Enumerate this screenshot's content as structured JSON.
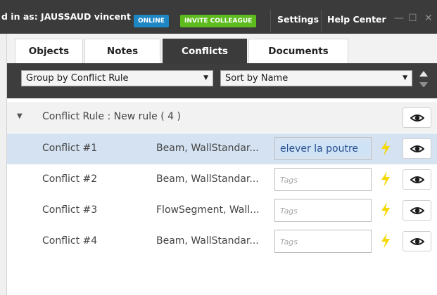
{
  "topbar": {
    "logged_in_text": "d in as: JAUSSAUD vincent",
    "online_badge": "ONLINE",
    "invite_button": "INVITE COLLEAGUE",
    "settings_label": "Settings",
    "help_label": "Help Center",
    "minimize_glyph": "—",
    "maximize_glyph": "☐",
    "close_glyph": "✕"
  },
  "tabs": [
    {
      "label": "Objects",
      "active": false
    },
    {
      "label": "Notes",
      "active": false
    },
    {
      "label": "Conflicts",
      "active": true
    },
    {
      "label": "Documents",
      "active": false
    }
  ],
  "toolbar": {
    "group_by_value": "Group by Conflict Rule",
    "sort_by_value": "Sort by Name"
  },
  "group": {
    "title": "Conflict Rule : New rule ( 4 )",
    "toggle_glyph": "▼"
  },
  "conflicts": [
    {
      "name": "Conflict #1",
      "types": "Beam, WallStandar...",
      "tags_value": "elever la poutre",
      "tags_placeholder": "Tags",
      "selected": true
    },
    {
      "name": "Conflict #2",
      "types": "Beam, WallStandar...",
      "tags_value": "",
      "tags_placeholder": "Tags",
      "selected": false
    },
    {
      "name": "Conflict #3",
      "types": "FlowSegment, Wall...",
      "tags_value": "",
      "tags_placeholder": "Tags",
      "selected": false
    },
    {
      "name": "Conflict #4",
      "types": "Beam, WallStandar...",
      "tags_value": "",
      "tags_placeholder": "Tags",
      "selected": false
    }
  ],
  "icons": {
    "eye": "eye-icon",
    "bolt": "lightning-icon",
    "dropdown": "chevron-down-icon"
  },
  "colors": {
    "topbar_bg": "#3b3b3b",
    "online_badge": "#1f86c4",
    "invite_badge": "#5dbb1e",
    "selected_row": "#d4e2f2",
    "bolt": "#f5d800"
  }
}
